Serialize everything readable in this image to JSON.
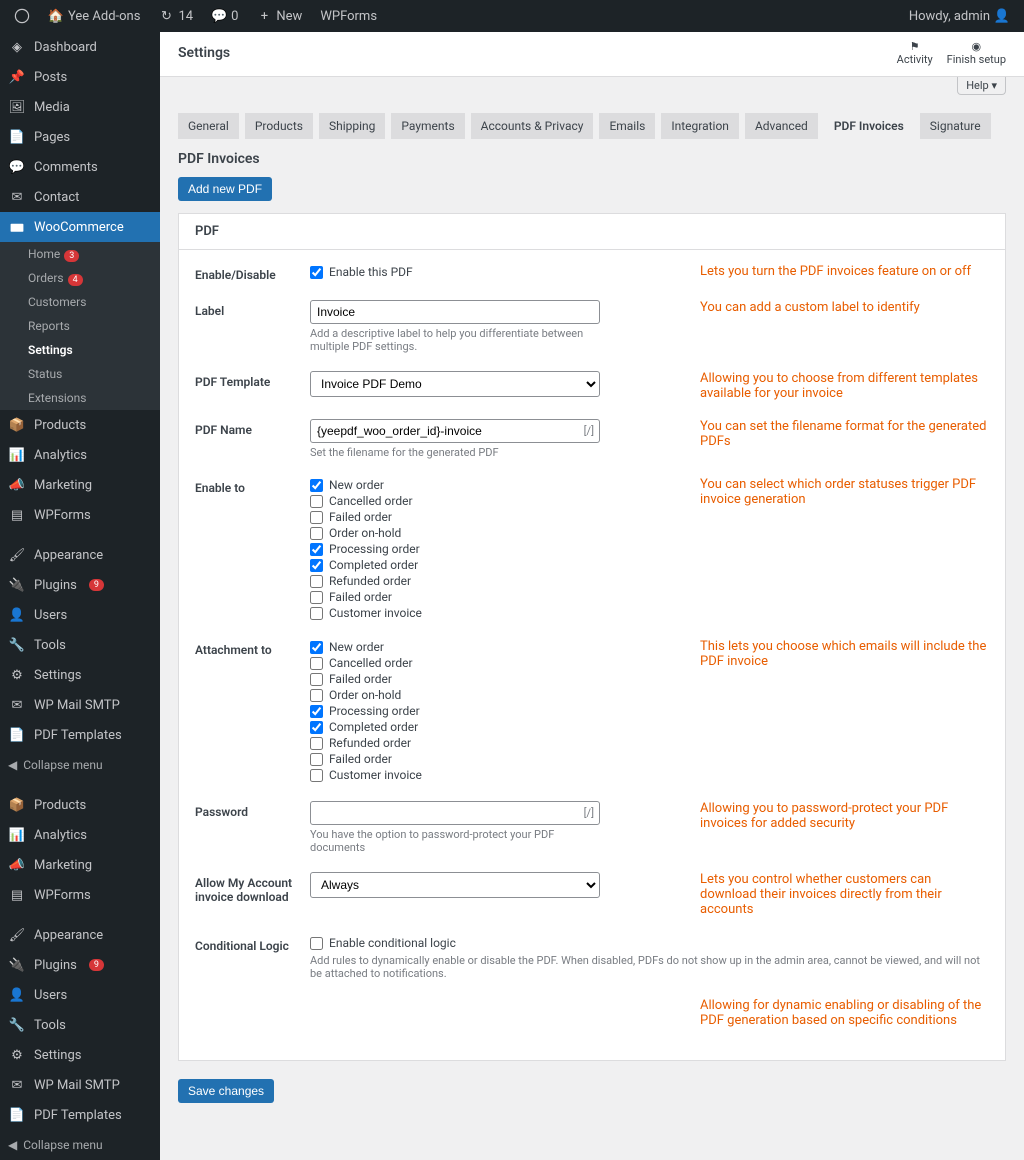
{
  "adminBar": {
    "site": "Yee Add-ons",
    "updates": "14",
    "comments": "0",
    "new": "New",
    "wpforms": "WPForms",
    "howdy": "Howdy, admin"
  },
  "topActions": {
    "activity": "Activity",
    "finish": "Finish setup",
    "help": "Help"
  },
  "pageTitle": "Settings",
  "sidebar": {
    "items": [
      {
        "label": "Dashboard",
        "icon": "dashboard"
      },
      {
        "label": "Posts",
        "icon": "pin"
      },
      {
        "label": "Media",
        "icon": "media"
      },
      {
        "label": "Pages",
        "icon": "page"
      },
      {
        "label": "Comments",
        "icon": "comment"
      },
      {
        "label": "Contact",
        "icon": "contact"
      }
    ],
    "woocommerce": "WooCommerce",
    "wooSub": [
      {
        "label": "Home",
        "badge": "3"
      },
      {
        "label": "Orders",
        "badge": "4"
      },
      {
        "label": "Customers"
      },
      {
        "label": "Reports"
      },
      {
        "label": "Settings",
        "current": true
      },
      {
        "label": "Status"
      },
      {
        "label": "Extensions"
      }
    ],
    "items2": [
      {
        "label": "Products",
        "icon": "products"
      },
      {
        "label": "Analytics",
        "icon": "analytics"
      },
      {
        "label": "Marketing",
        "icon": "marketing"
      },
      {
        "label": "WPForms",
        "icon": "wpforms"
      }
    ],
    "items3": [
      {
        "label": "Appearance",
        "icon": "appearance"
      },
      {
        "label": "Plugins",
        "icon": "plugins",
        "badge": "9"
      },
      {
        "label": "Users",
        "icon": "users"
      },
      {
        "label": "Tools",
        "icon": "tools"
      },
      {
        "label": "Settings",
        "icon": "settings"
      },
      {
        "label": "WP Mail SMTP",
        "icon": "mail"
      },
      {
        "label": "PDF Templates",
        "icon": "pdf"
      }
    ],
    "collapse": "Collapse menu",
    "items4": [
      {
        "label": "Products",
        "icon": "products"
      },
      {
        "label": "Analytics",
        "icon": "analytics"
      },
      {
        "label": "Marketing",
        "icon": "marketing"
      },
      {
        "label": "WPForms",
        "icon": "wpforms"
      }
    ],
    "items5": [
      {
        "label": "Appearance",
        "icon": "appearance"
      },
      {
        "label": "Plugins",
        "icon": "plugins",
        "badge": "9"
      },
      {
        "label": "Users",
        "icon": "users"
      },
      {
        "label": "Tools",
        "icon": "tools"
      },
      {
        "label": "Settings",
        "icon": "settings"
      },
      {
        "label": "WP Mail SMTP",
        "icon": "mail"
      },
      {
        "label": "PDF Templates",
        "icon": "pdf"
      }
    ]
  },
  "tabs": [
    "General",
    "Products",
    "Shipping",
    "Payments",
    "Accounts & Privacy",
    "Emails",
    "Integration",
    "Advanced",
    "PDF Invoices",
    "Signature"
  ],
  "sectionTitle": "PDF Invoices",
  "addButton": "Add new PDF",
  "panelTitle": "PDF",
  "form": {
    "enable": {
      "label": "Enable/Disable",
      "text": "Enable this PDF"
    },
    "label": {
      "label": "Label",
      "value": "Invoice",
      "help": "Add a descriptive label to help you differentiate between multiple PDF settings."
    },
    "template": {
      "label": "PDF Template",
      "value": "Invoice PDF Demo"
    },
    "name": {
      "label": "PDF Name",
      "value": "{yeepdf_woo_order_id}-invoice",
      "help": "Set the filename for the generated PDF",
      "suffix": "[/]"
    },
    "enableTo": {
      "label": "Enable to"
    },
    "attach": {
      "label": "Attachment to"
    },
    "statuses": [
      "New order",
      "Cancelled order",
      "Failed order",
      "Order on-hold",
      "Processing order",
      "Completed order",
      "Refunded order",
      "Failed order",
      "Customer invoice"
    ],
    "enableToChecked": [
      true,
      false,
      false,
      false,
      true,
      true,
      false,
      false,
      false
    ],
    "attachChecked": [
      true,
      false,
      false,
      false,
      true,
      true,
      false,
      false,
      false
    ],
    "password": {
      "label": "Password",
      "help": "You have the option to password-protect your PDF documents",
      "suffix": "[/]"
    },
    "myaccount": {
      "label": "Allow My Account invoice download",
      "value": "Always"
    },
    "conditional": {
      "label": "Conditional Logic",
      "text": "Enable conditional logic",
      "help": "Add rules to dynamically enable or disable the PDF. When disabled, PDFs do not show up in the admin area, cannot be viewed, and will not be attached to notifications."
    }
  },
  "annotations": {
    "enable": "Lets you turn the PDF invoices feature on or off",
    "label": "You can add a custom label to identify",
    "template": "Allowing you to choose from different templates available for your invoice",
    "name": "You can set the filename format for the generated PDFs",
    "enableTo": "You can select which order statuses trigger PDF invoice generation",
    "attach": "This lets you choose which emails will include the PDF invoice",
    "password": "Allowing you to password-protect your PDF invoices for added security",
    "myaccount": "Lets you control whether customers can download their invoices directly from their accounts",
    "conditional": "Allowing for dynamic enabling or disabling of the PDF generation based on specific conditions"
  },
  "saveButton": "Save changes"
}
